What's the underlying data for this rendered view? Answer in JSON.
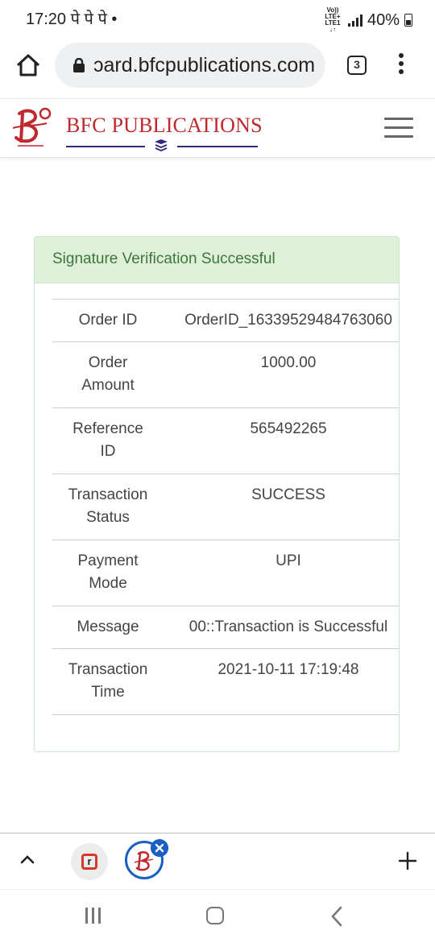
{
  "status_bar": {
    "time": "17:20 पे पे पे •",
    "network": "Vo)) LTE+ LTE1 ↓↑",
    "battery": "40%"
  },
  "browser": {
    "url": "ɔard.bfcpublications.com",
    "tab_count": "3"
  },
  "site": {
    "brand": "BFC PUBLICATIONS",
    "brand_color": "#c0282e"
  },
  "card": {
    "title": "Signature Verification Successful",
    "header_bg": "#dff0d8",
    "title_color": "#3c763d",
    "rows": [
      {
        "label": "Order ID",
        "value": "OrderID_16339529484763060"
      },
      {
        "label": "Order Amount",
        "value": "1000.00"
      },
      {
        "label": "Reference ID",
        "value": "565492265"
      },
      {
        "label": "Transaction Status",
        "value": "SUCCESS"
      },
      {
        "label": "Payment Mode",
        "value": "UPI"
      },
      {
        "label": "Message",
        "value": "00::Transaction is Successful"
      },
      {
        "label": "Transaction Time",
        "value": "2021-10-11 17:19:48"
      }
    ]
  },
  "tab_strip": {
    "r_tab_label": "r",
    "accent": "#1a5fc4"
  }
}
